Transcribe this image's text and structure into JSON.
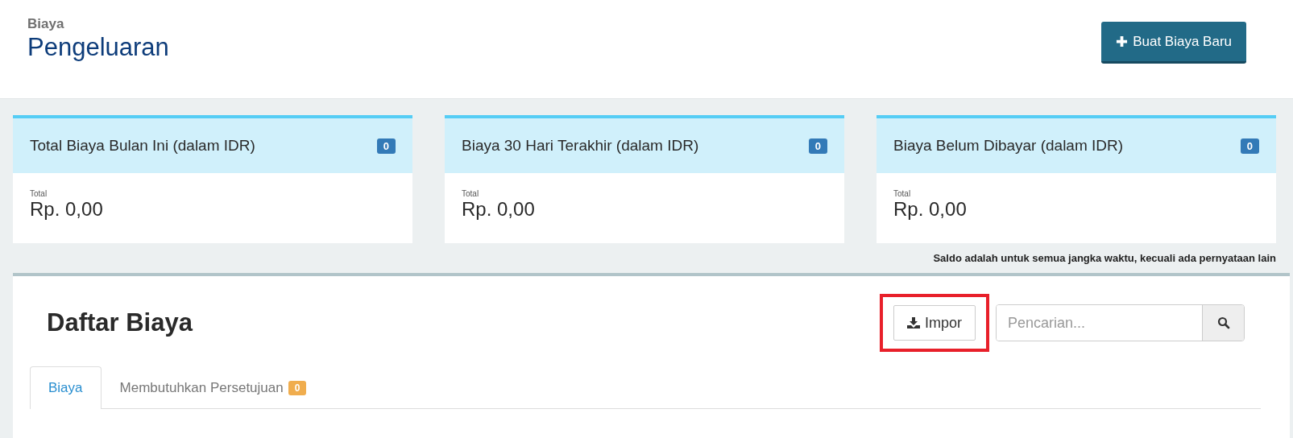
{
  "header": {
    "breadcrumb": "Biaya",
    "title": "Pengeluaran",
    "new_button": "Buat Biaya Baru"
  },
  "cards": [
    {
      "title": "Total Biaya Bulan Ini (dalam IDR)",
      "badge": "0",
      "total_label": "Total",
      "amount": "Rp. 0,00"
    },
    {
      "title": "Biaya 30 Hari Terakhir (dalam IDR)",
      "badge": "0",
      "total_label": "Total",
      "amount": "Rp. 0,00"
    },
    {
      "title": "Biaya Belum Dibayar (dalam IDR)",
      "badge": "0",
      "total_label": "Total",
      "amount": "Rp. 0,00"
    }
  ],
  "note": "Saldo adalah untuk semua jangka waktu, kecuali ada pernyataan lain",
  "list": {
    "title": "Daftar Biaya",
    "import_button": {
      "label": "Impor",
      "highlighted": true
    },
    "search": {
      "placeholder": "Pencarian..."
    },
    "tabs": [
      {
        "label": "Biaya",
        "selected": true
      },
      {
        "label": "Membutuhkan Persetujuan",
        "selected": false,
        "badge": "0"
      }
    ]
  }
}
